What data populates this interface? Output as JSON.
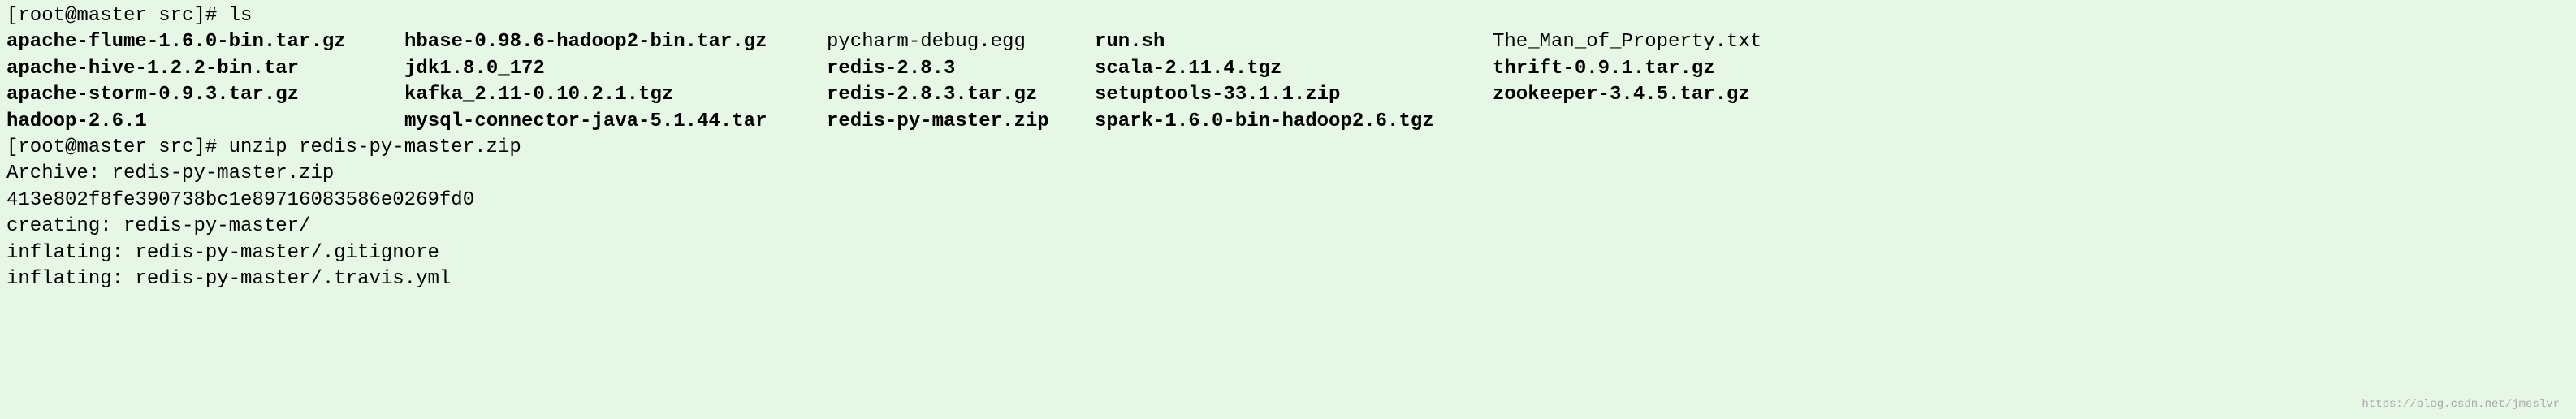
{
  "prompt1": {
    "user_host": "[root@master src]#",
    "command": "ls"
  },
  "ls": {
    "col1": [
      {
        "name": "apache-flume-1.6.0-bin.tar.gz",
        "bold": true
      },
      {
        "name": "apache-hive-1.2.2-bin.tar",
        "bold": true
      },
      {
        "name": "apache-storm-0.9.3.tar.gz",
        "bold": true
      },
      {
        "name": "hadoop-2.6.1",
        "bold": true
      }
    ],
    "col2": [
      {
        "name": "hbase-0.98.6-hadoop2-bin.tar.gz",
        "bold": true
      },
      {
        "name": "jdk1.8.0_172",
        "bold": true
      },
      {
        "name": "kafka_2.11-0.10.2.1.tgz",
        "bold": true
      },
      {
        "name": "mysql-connector-java-5.1.44.tar",
        "bold": true
      }
    ],
    "col3": [
      {
        "name": "pycharm-debug.egg",
        "bold": false
      },
      {
        "name": "redis-2.8.3",
        "bold": true
      },
      {
        "name": "redis-2.8.3.tar.gz",
        "bold": true
      },
      {
        "name": "redis-py-master.zip",
        "bold": true
      }
    ],
    "col4": [
      {
        "name": "run.sh",
        "bold": true
      },
      {
        "name": "scala-2.11.4.tgz",
        "bold": true
      },
      {
        "name": "setuptools-33.1.1.zip",
        "bold": true
      },
      {
        "name": "spark-1.6.0-bin-hadoop2.6.tgz",
        "bold": true
      }
    ],
    "col5": [
      {
        "name": "The_Man_of_Property.txt",
        "bold": false
      },
      {
        "name": "thrift-0.9.1.tar.gz",
        "bold": true
      },
      {
        "name": "zookeeper-3.4.5.tar.gz",
        "bold": true
      }
    ]
  },
  "prompt2": {
    "user_host": "[root@master src]#",
    "command": "unzip redis-py-master.zip"
  },
  "unzip_output": {
    "line1": "Archive:  redis-py-master.zip",
    "line2": "413e802f8fe390738bc1e89716083586e0269fd0",
    "line3": "   creating: redis-py-master/",
    "line4": "  inflating: redis-py-master/.gitignore",
    "line5": "  inflating: redis-py-master/.travis.yml"
  },
  "watermark": "https://blog.csdn.net/jmeslvr"
}
